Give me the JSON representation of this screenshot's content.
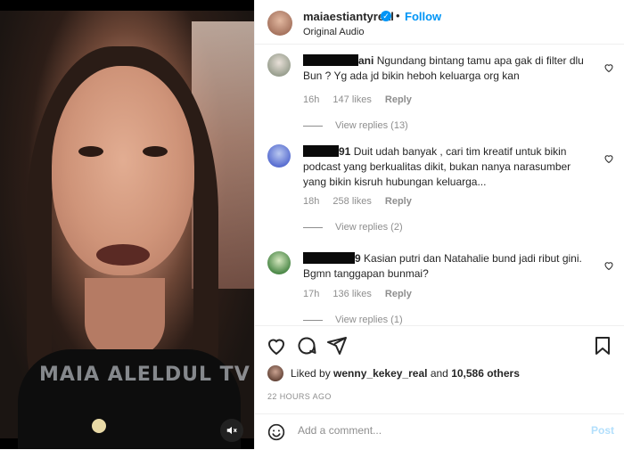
{
  "media": {
    "watermark": "MAIA ALELDUL TV",
    "mute_icon": "speaker-muted-icon"
  },
  "header": {
    "username": "maiaestiantyreal",
    "separator": "•",
    "follow_label": "Follow",
    "audio": "Original Audio"
  },
  "comments": [
    {
      "username_suffix": "ani",
      "text": "Ngundang bintang tamu apa gak di filter dlu Bun ? Yg ada jd bikin heboh keluarga org kan",
      "time": "16h",
      "likes": "147 likes",
      "reply": "Reply",
      "view_replies": "View replies (13)"
    },
    {
      "username_suffix": "91",
      "text": "Duit udah banyak , cari tim kreatif untuk bikin podcast yang berkualitas dikit, bukan nanya narasumber yang bikin kisruh hubungan keluarga...",
      "time": "18h",
      "likes": "258 likes",
      "reply": "Reply",
      "view_replies": "View replies (2)"
    },
    {
      "username_suffix": "9",
      "text": "Kasian putri dan Natahalie bund jadi ribut gini. Bgmn tanggapan bunmai?",
      "time": "17h",
      "likes": "136 likes",
      "reply": "Reply",
      "view_replies": "View replies (1)"
    }
  ],
  "likes_line": {
    "prefix": "Liked by",
    "user": "wenny_kekey_real",
    "and": "and",
    "others": "10,586 others"
  },
  "posted_time": "22 HOURS AGO",
  "add_comment": {
    "placeholder": "Add a comment...",
    "post_label": "Post"
  },
  "colors": {
    "accent": "#0095f6",
    "post_disabled": "#b2dffc",
    "muted": "#8e8e8e"
  }
}
